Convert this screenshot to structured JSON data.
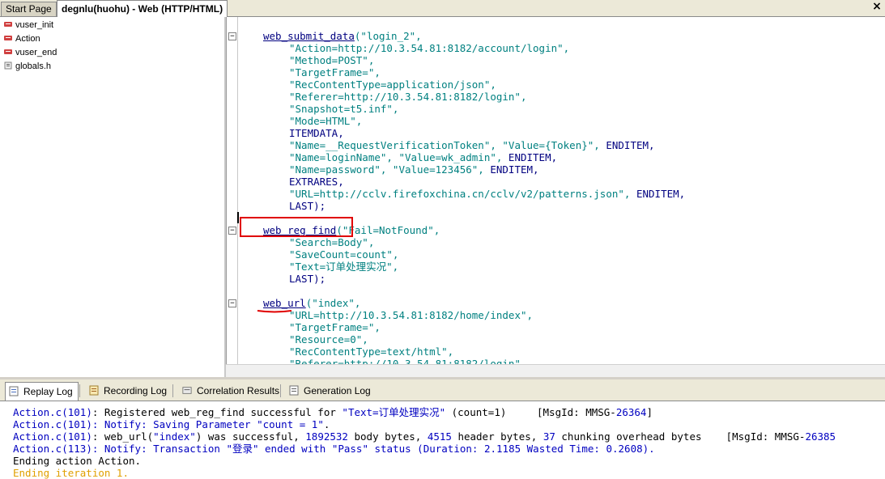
{
  "tabs": {
    "start_page": "Start Page",
    "active": "degnlu(huohu) - Web (HTTP/HTML)",
    "close": "×"
  },
  "tree": {
    "items": [
      "vuser_init",
      "Action",
      "vuser_end",
      "globals.h"
    ]
  },
  "code": {
    "l01a": "web_submit_data",
    "l01b": "(\"login_2\",",
    "l02": "\"Action=http://10.3.54.81:8182/account/login\",",
    "l03": "\"Method=POST\",",
    "l04": "\"TargetFrame=\",",
    "l05": "\"RecContentType=application/json\",",
    "l06": "\"Referer=http://10.3.54.81:8182/login\",",
    "l07": "\"Snapshot=t5.inf\",",
    "l08": "\"Mode=HTML\",",
    "l09": "ITEMDATA,",
    "l10a": "\"Name=__RequestVerificationToken\", \"Value={Token}\",",
    "l10b": " ENDITEM,",
    "l11a": "\"Name=loginName\", \"Value=wk_admin\",",
    "l11b": " ENDITEM,",
    "l12a": "\"Name=password\", \"Value=123456\",",
    "l12b": " ENDITEM,",
    "l13": "EXTRARES,",
    "l14a": "\"URL=http://cclv.firefoxchina.cn/cclv/v2/patterns.json\",",
    "l14b": " ENDITEM,",
    "l15": "LAST);",
    "l16a": "web_reg_find",
    "l16b": "(\"Fail=NotFound\",",
    "l17": "\"Search=Body\",",
    "l18": "\"SaveCount=count\",",
    "l19": "\"Text=订单处理实况\",",
    "l20": "LAST);",
    "l21a": "web_url",
    "l21b": "(\"index\",",
    "l22": "\"URL=http://10.3.54.81:8182/home/index\",",
    "l23": "\"TargetFrame=\",",
    "l24": "\"Resource=0\",",
    "l25": "\"RecContentType=text/html\",",
    "l26": "\"Referer=http://10.3.54.81:8182/login\","
  },
  "log_tabs": [
    "Replay Log",
    "Recording Log",
    "Correlation Results",
    "Generation Log"
  ],
  "log": {
    "r1a": "Action.c",
    "r1b": "(101)",
    "r1c": ": Registered web_reg_find successful for ",
    "r1d": "\"Text=订单处理实况\"",
    "r1e": " (count=1)     [MsgId: MMSG-",
    "r1f": "26364",
    "r1g": "]",
    "r2a": "Action.c",
    "r2b": "(101)",
    "r2c": ": Notify: Saving Parameter ",
    "r2d": "\"count = 1\"",
    "r2e": ".",
    "r3a": "Action.c",
    "r3b": "(101)",
    "r3c": ": web_url(",
    "r3d": "\"index\"",
    "r3e": ") was successful, ",
    "r3f": "1892532",
    "r3g": " body bytes, ",
    "r3h": "4515",
    "r3i": " header bytes, ",
    "r3j": "37",
    "r3k": " chunking overhead bytes    [MsgId: MMSG-",
    "r3l": "26385",
    "r4a": "Action.c",
    "r4b": "(113)",
    "r4c": ": Notify: Transaction ",
    "r4d": "\"登录\"",
    "r4e": " ended with ",
    "r4f": "\"Pass\"",
    "r4g": " status (Duration: ",
    "r4h": "2.1185",
    "r4i": " Wasted Time: ",
    "r4j": "0.2608",
    "r4k": ").",
    "r5": "Ending action Action.",
    "r6": "Ending iteration 1."
  },
  "colors": {
    "function": "#000080",
    "string": "#008080",
    "highlight": "#e00000",
    "log_blue": "#0000c0"
  }
}
